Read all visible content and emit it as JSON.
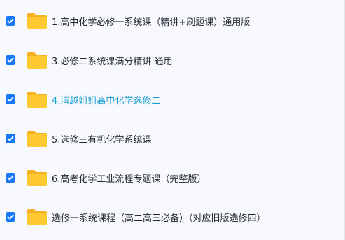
{
  "colors": {
    "checkbox": "#1677ff",
    "folder_body": "#ffc933",
    "folder_tab": "#f5b120",
    "text": "#222a35",
    "highlight_text": "#1a9fd6",
    "background": "#f7f9fc"
  },
  "files": [
    {
      "name": "1.高中化学必修一系统课（精讲+刷题课）通用版",
      "checked": true,
      "icon": "folder-icon",
      "highlighted": false
    },
    {
      "name": "3.必修二系统课满分精讲 通用",
      "checked": true,
      "icon": "folder-icon",
      "highlighted": false
    },
    {
      "name": "4.清越姐姐高中化学选修二",
      "checked": true,
      "icon": "folder-icon",
      "highlighted": true
    },
    {
      "name": "5.选修三有机化学系统课",
      "checked": true,
      "icon": "folder-icon",
      "highlighted": false
    },
    {
      "name": "6.高考化学工业流程专题课（完整版）",
      "checked": true,
      "icon": "folder-icon",
      "highlighted": false
    },
    {
      "name": "选修一系统课程（高二高三必备）（对应旧版选修四）",
      "checked": true,
      "icon": "folder-icon",
      "highlighted": false
    }
  ]
}
